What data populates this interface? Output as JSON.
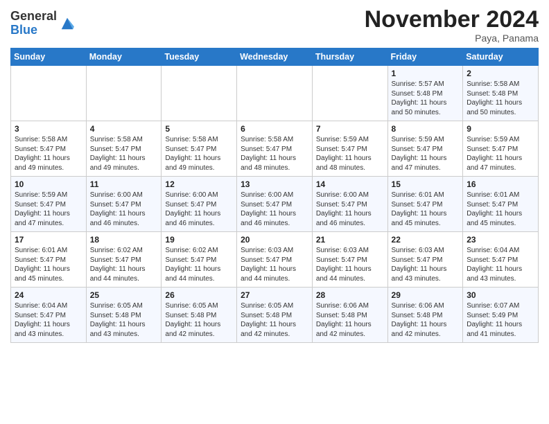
{
  "logo": {
    "text_general": "General",
    "text_blue": "Blue"
  },
  "header": {
    "month": "November 2024",
    "location": "Paya, Panama"
  },
  "weekdays": [
    "Sunday",
    "Monday",
    "Tuesday",
    "Wednesday",
    "Thursday",
    "Friday",
    "Saturday"
  ],
  "weeks": [
    [
      {
        "day": "",
        "detail": ""
      },
      {
        "day": "",
        "detail": ""
      },
      {
        "day": "",
        "detail": ""
      },
      {
        "day": "",
        "detail": ""
      },
      {
        "day": "",
        "detail": ""
      },
      {
        "day": "1",
        "detail": "Sunrise: 5:57 AM\nSunset: 5:48 PM\nDaylight: 11 hours\nand 50 minutes."
      },
      {
        "day": "2",
        "detail": "Sunrise: 5:58 AM\nSunset: 5:48 PM\nDaylight: 11 hours\nand 50 minutes."
      }
    ],
    [
      {
        "day": "3",
        "detail": "Sunrise: 5:58 AM\nSunset: 5:47 PM\nDaylight: 11 hours\nand 49 minutes."
      },
      {
        "day": "4",
        "detail": "Sunrise: 5:58 AM\nSunset: 5:47 PM\nDaylight: 11 hours\nand 49 minutes."
      },
      {
        "day": "5",
        "detail": "Sunrise: 5:58 AM\nSunset: 5:47 PM\nDaylight: 11 hours\nand 49 minutes."
      },
      {
        "day": "6",
        "detail": "Sunrise: 5:58 AM\nSunset: 5:47 PM\nDaylight: 11 hours\nand 48 minutes."
      },
      {
        "day": "7",
        "detail": "Sunrise: 5:59 AM\nSunset: 5:47 PM\nDaylight: 11 hours\nand 48 minutes."
      },
      {
        "day": "8",
        "detail": "Sunrise: 5:59 AM\nSunset: 5:47 PM\nDaylight: 11 hours\nand 47 minutes."
      },
      {
        "day": "9",
        "detail": "Sunrise: 5:59 AM\nSunset: 5:47 PM\nDaylight: 11 hours\nand 47 minutes."
      }
    ],
    [
      {
        "day": "10",
        "detail": "Sunrise: 5:59 AM\nSunset: 5:47 PM\nDaylight: 11 hours\nand 47 minutes."
      },
      {
        "day": "11",
        "detail": "Sunrise: 6:00 AM\nSunset: 5:47 PM\nDaylight: 11 hours\nand 46 minutes."
      },
      {
        "day": "12",
        "detail": "Sunrise: 6:00 AM\nSunset: 5:47 PM\nDaylight: 11 hours\nand 46 minutes."
      },
      {
        "day": "13",
        "detail": "Sunrise: 6:00 AM\nSunset: 5:47 PM\nDaylight: 11 hours\nand 46 minutes."
      },
      {
        "day": "14",
        "detail": "Sunrise: 6:00 AM\nSunset: 5:47 PM\nDaylight: 11 hours\nand 46 minutes."
      },
      {
        "day": "15",
        "detail": "Sunrise: 6:01 AM\nSunset: 5:47 PM\nDaylight: 11 hours\nand 45 minutes."
      },
      {
        "day": "16",
        "detail": "Sunrise: 6:01 AM\nSunset: 5:47 PM\nDaylight: 11 hours\nand 45 minutes."
      }
    ],
    [
      {
        "day": "17",
        "detail": "Sunrise: 6:01 AM\nSunset: 5:47 PM\nDaylight: 11 hours\nand 45 minutes."
      },
      {
        "day": "18",
        "detail": "Sunrise: 6:02 AM\nSunset: 5:47 PM\nDaylight: 11 hours\nand 44 minutes."
      },
      {
        "day": "19",
        "detail": "Sunrise: 6:02 AM\nSunset: 5:47 PM\nDaylight: 11 hours\nand 44 minutes."
      },
      {
        "day": "20",
        "detail": "Sunrise: 6:03 AM\nSunset: 5:47 PM\nDaylight: 11 hours\nand 44 minutes."
      },
      {
        "day": "21",
        "detail": "Sunrise: 6:03 AM\nSunset: 5:47 PM\nDaylight: 11 hours\nand 44 minutes."
      },
      {
        "day": "22",
        "detail": "Sunrise: 6:03 AM\nSunset: 5:47 PM\nDaylight: 11 hours\nand 43 minutes."
      },
      {
        "day": "23",
        "detail": "Sunrise: 6:04 AM\nSunset: 5:47 PM\nDaylight: 11 hours\nand 43 minutes."
      }
    ],
    [
      {
        "day": "24",
        "detail": "Sunrise: 6:04 AM\nSunset: 5:47 PM\nDaylight: 11 hours\nand 43 minutes."
      },
      {
        "day": "25",
        "detail": "Sunrise: 6:05 AM\nSunset: 5:48 PM\nDaylight: 11 hours\nand 43 minutes."
      },
      {
        "day": "26",
        "detail": "Sunrise: 6:05 AM\nSunset: 5:48 PM\nDaylight: 11 hours\nand 42 minutes."
      },
      {
        "day": "27",
        "detail": "Sunrise: 6:05 AM\nSunset: 5:48 PM\nDaylight: 11 hours\nand 42 minutes."
      },
      {
        "day": "28",
        "detail": "Sunrise: 6:06 AM\nSunset: 5:48 PM\nDaylight: 11 hours\nand 42 minutes."
      },
      {
        "day": "29",
        "detail": "Sunrise: 6:06 AM\nSunset: 5:48 PM\nDaylight: 11 hours\nand 42 minutes."
      },
      {
        "day": "30",
        "detail": "Sunrise: 6:07 AM\nSunset: 5:49 PM\nDaylight: 11 hours\nand 41 minutes."
      }
    ]
  ]
}
